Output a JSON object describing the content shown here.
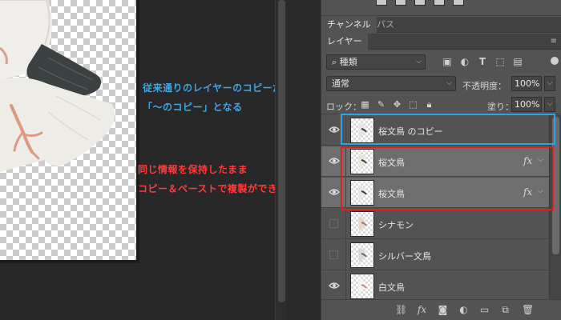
{
  "annotations": {
    "blue_line": "従来通りのレイヤーのコピーだと",
    "blue_line2": "「〜のコピー」となる",
    "red_line1": "同じ情報を保持したまま",
    "red_line2": "コピー＆ペーストで複製ができる！"
  },
  "tabs": {
    "channels": "チャンネル",
    "paths": "パス",
    "layers": "レイヤー"
  },
  "filter": {
    "kind_label": "種類",
    "kind_icon": "search-icon"
  },
  "blend": {
    "mode": "通常",
    "opacity_label": "不透明度：",
    "opacity_value": "100%"
  },
  "lock": {
    "label": "ロック：",
    "fill_label": "塗り：",
    "fill_value": "100%"
  },
  "layers": [
    {
      "name": "桜文鳥 のコピー",
      "visible": true,
      "selected": false,
      "fx": false
    },
    {
      "name": "桜文鳥",
      "visible": true,
      "selected": true,
      "fx": true
    },
    {
      "name": "桜文鳥",
      "visible": true,
      "selected": true,
      "fx": true
    },
    {
      "name": "シナモン",
      "visible": false,
      "selected": false,
      "fx": false
    },
    {
      "name": "シルバー文鳥",
      "visible": false,
      "selected": false,
      "fx": false
    },
    {
      "name": "白文鳥",
      "visible": true,
      "selected": false,
      "fx": false
    }
  ],
  "fx_label": "fx",
  "colors": {
    "highlight_blue": "#2aa5e4",
    "highlight_red": "#e0201e",
    "annotation_blue": "#3ba7e6",
    "annotation_red": "#ff3b3b"
  }
}
